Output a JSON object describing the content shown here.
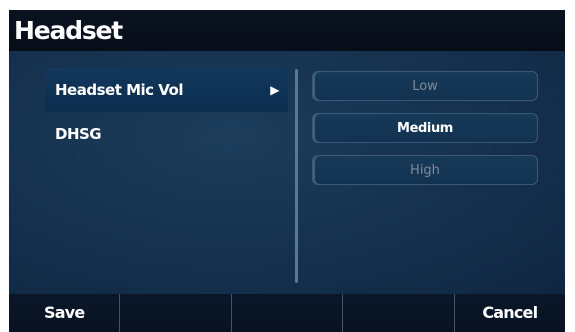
{
  "title": "Headset",
  "menu": {
    "items": [
      {
        "label": "Headset Mic Vol",
        "selected": true,
        "has_submenu": true
      },
      {
        "label": "DHSG",
        "selected": false
      }
    ],
    "arrow_icon": "triangle-right-icon"
  },
  "options": {
    "items": [
      {
        "label": "Low",
        "active": false
      },
      {
        "label": "Medium",
        "active": true
      },
      {
        "label": "High",
        "active": false
      }
    ]
  },
  "softkeys": [
    {
      "label": "Save"
    },
    {
      "label": ""
    },
    {
      "label": ""
    },
    {
      "label": ""
    },
    {
      "label": "Cancel"
    }
  ],
  "colors": {
    "background": "#163350",
    "title_bar": "#0a1322",
    "selected_item": "#12385c",
    "softkey_bar": "#0a1424",
    "text": "#ffffff",
    "inactive_text": "#7d8b99"
  }
}
